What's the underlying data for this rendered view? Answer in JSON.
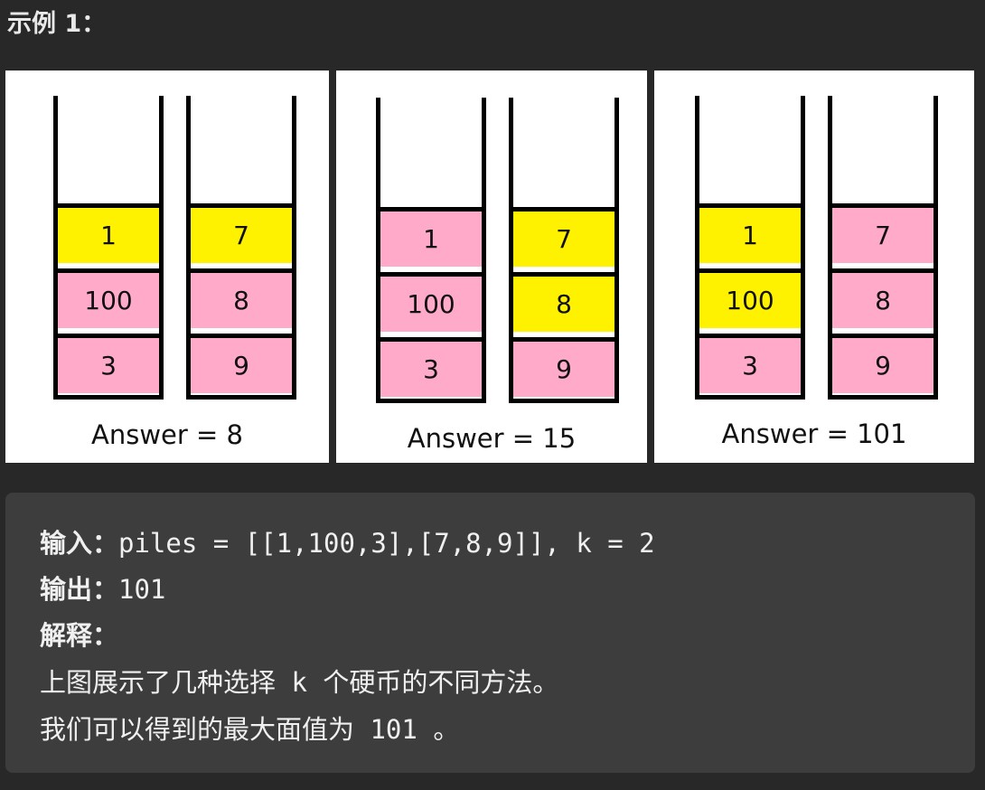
{
  "heading": "示例 1：",
  "panels": [
    {
      "answer": "Answer = 8",
      "piles": [
        [
          {
            "v": "1",
            "sel": true
          },
          {
            "v": "100",
            "sel": false
          },
          {
            "v": "3",
            "sel": false
          }
        ],
        [
          {
            "v": "7",
            "sel": true
          },
          {
            "v": "8",
            "sel": false
          },
          {
            "v": "9",
            "sel": false
          }
        ]
      ]
    },
    {
      "answer": "Answer = 15",
      "piles": [
        [
          {
            "v": "1",
            "sel": false
          },
          {
            "v": "100",
            "sel": false
          },
          {
            "v": "3",
            "sel": false
          }
        ],
        [
          {
            "v": "7",
            "sel": true
          },
          {
            "v": "8",
            "sel": true
          },
          {
            "v": "9",
            "sel": false
          }
        ]
      ]
    },
    {
      "answer": "Answer = 101",
      "piles": [
        [
          {
            "v": "1",
            "sel": true
          },
          {
            "v": "100",
            "sel": true
          },
          {
            "v": "3",
            "sel": false
          }
        ],
        [
          {
            "v": "7",
            "sel": false
          },
          {
            "v": "8",
            "sel": false
          },
          {
            "v": "9",
            "sel": false
          }
        ]
      ]
    }
  ],
  "colors": {
    "selected": "#fff200",
    "unselected": "#ffaac9"
  },
  "example": {
    "input_label": "输入：",
    "input_value": "piles = [[1,100,3],[7,8,9]], k = 2",
    "output_label": "输出：",
    "output_value": "101",
    "explain_label": "解释：",
    "explain_line1_a": "上图展示了几种选择",
    "explain_line1_b": " k ",
    "explain_line1_c": "个硬币的不同方法。",
    "explain_line2_a": "我们可以得到的最大面值为",
    "explain_line2_b": " 101 ",
    "explain_line2_c": "。"
  }
}
